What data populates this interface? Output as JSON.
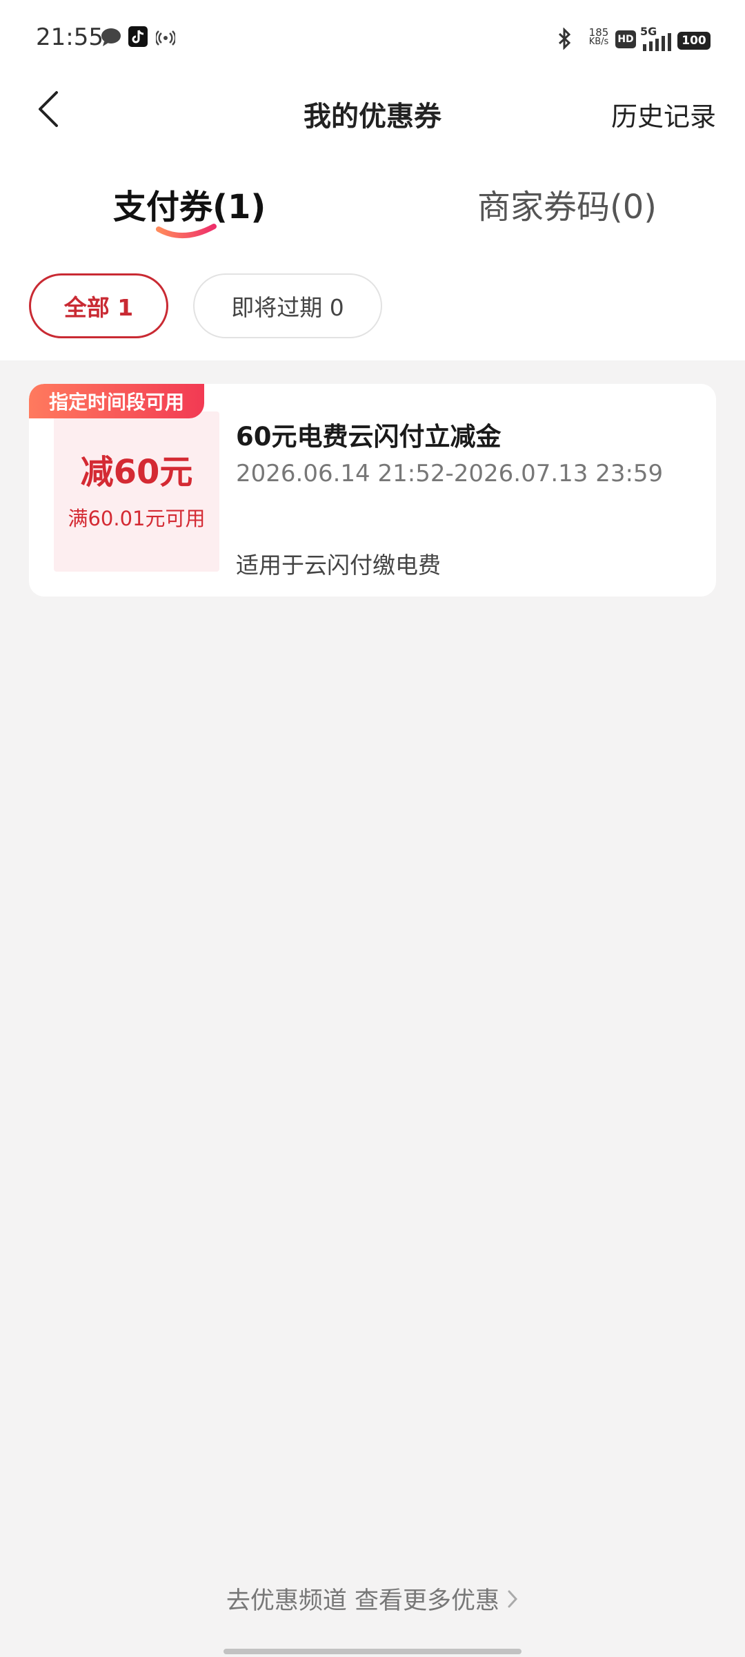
{
  "status_bar": {
    "time": "21:55",
    "net_speed_value": "185",
    "net_speed_unit": "KB/s",
    "hd_label": "HD",
    "network_label": "5G",
    "battery": "100"
  },
  "header": {
    "title": "我的优惠券",
    "history_label": "历史记录"
  },
  "tabs": [
    {
      "label": "支付券(1)",
      "active": true
    },
    {
      "label": "商家券码(0)",
      "active": false
    }
  ],
  "filters": [
    {
      "label": "全部 1",
      "active": true
    },
    {
      "label": "即将过期 0",
      "active": false
    }
  ],
  "coupons": [
    {
      "tag": "指定时间段可用",
      "amount": "减60元",
      "condition": "满60.01元可用",
      "title": "60元电费云闪付立减金",
      "validity": "2026.06.14 21:52-2026.07.13 23:59",
      "scope": "适用于云闪付缴电费"
    }
  ],
  "footer": {
    "more_link": "去优惠频道 查看更多优惠"
  },
  "colors": {
    "accent_red": "#c92a33",
    "coupon_red": "#d42a33",
    "tag_gradient_start": "#ff7a5e",
    "tag_gradient_end": "#f23a53",
    "background": "#f4f3f3"
  }
}
